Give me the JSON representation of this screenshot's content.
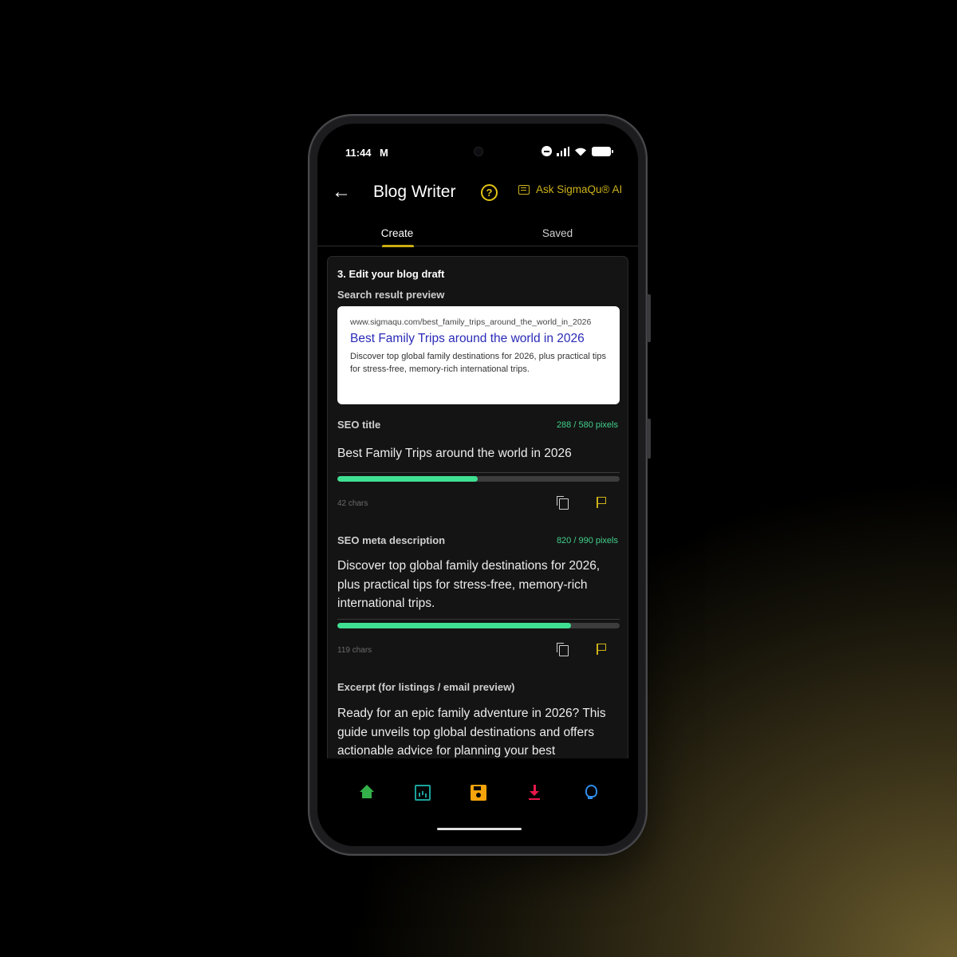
{
  "status_bar": {
    "time": "11:44",
    "mail_icon": "M"
  },
  "app_bar": {
    "back_icon": "←",
    "title": "Blog Writer",
    "help_icon": "?",
    "ask_label": "Ask SigmaQu® AI"
  },
  "tabs": [
    {
      "label": "Create",
      "selected": true
    },
    {
      "label": "Saved",
      "selected": false
    }
  ],
  "card": {
    "heading": "3. Edit your blog draft",
    "preview_label": "Search result preview",
    "preview": {
      "url": "www.sigmaqu.com/best_family_trips_around_the_world_in_2026",
      "title": "Best Family Trips around the world in 2026",
      "description": "Discover top global family destinations for 2026, plus practical tips for stress-free, memory-rich international trips."
    },
    "seo_title": {
      "label": "SEO title",
      "pixels": "288 / 580 pixels",
      "value": "Best Family Trips around the world in 2026",
      "progress": 0.497,
      "chars": "42 chars"
    },
    "seo_meta": {
      "label": "SEO meta description",
      "pixels": "820 / 990 pixels",
      "value": "Discover top global family destinations for 2026, plus practical tips for stress-free, memory-rich international trips.",
      "progress": 0.828,
      "chars": "119 chars"
    },
    "excerpt": {
      "label": "Excerpt (for listings / email preview)",
      "value": "Ready for an epic family adventure in 2026? This guide unveils top global destinations and offers actionable advice for planning your best"
    }
  },
  "bottom_nav": [
    "home-icon",
    "chart-icon",
    "save-icon",
    "download-icon",
    "bulb-icon"
  ],
  "colors": {
    "accent": "#c9ad12",
    "progress": "#3fe092",
    "pixels_text": "#41d08b",
    "link": "#2a2bb8"
  }
}
